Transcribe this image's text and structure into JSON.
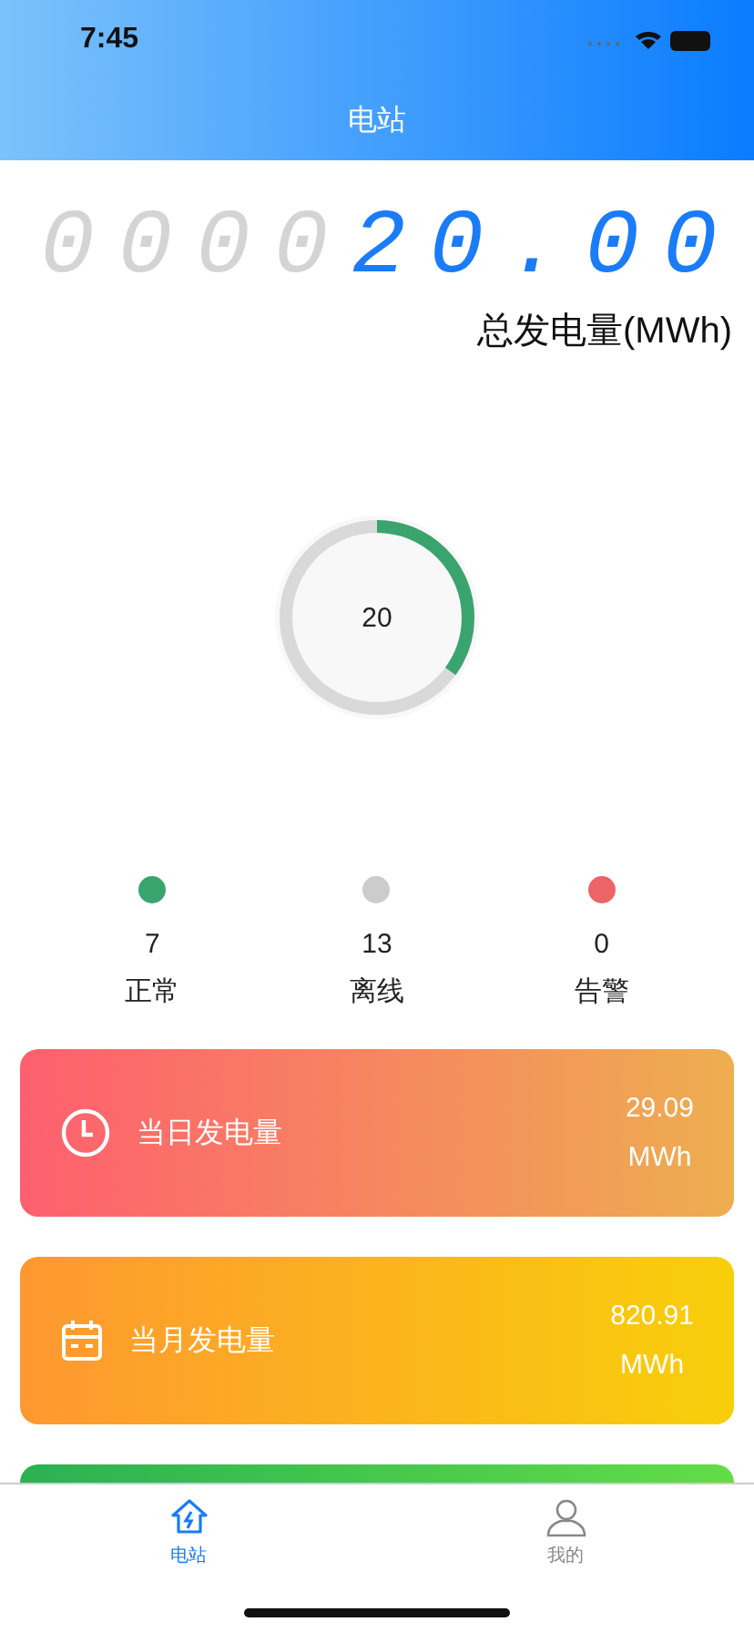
{
  "status_bar": {
    "time": "7:45"
  },
  "nav": {
    "title": "电站"
  },
  "counter": {
    "digits": [
      {
        "char": "0",
        "lit": false
      },
      {
        "char": "0",
        "lit": false
      },
      {
        "char": "0",
        "lit": false
      },
      {
        "char": "0",
        "lit": false
      },
      {
        "char": "2",
        "lit": true
      },
      {
        "char": "0",
        "lit": true
      },
      {
        "char": ".",
        "lit": true
      },
      {
        "char": "0",
        "lit": true
      },
      {
        "char": "0",
        "lit": true
      }
    ],
    "label": "总发电量(MWh)"
  },
  "gauge": {
    "value": "20",
    "level": 0.35
  },
  "statuses": [
    {
      "count": "7",
      "label": "正常",
      "color": "#3aa46f"
    },
    {
      "count": "13",
      "label": "离线",
      "color": "#cccccc"
    },
    {
      "count": "0",
      "label": "告警",
      "color": "#ee6466"
    }
  ],
  "cards": [
    {
      "kind": "daily",
      "label": "当日发电量",
      "value": "29.09",
      "unit": "MWh"
    },
    {
      "kind": "monthly",
      "label": "当月发电量",
      "value": "820.91",
      "unit": "MWh"
    },
    {
      "kind": "total"
    }
  ],
  "tabs": [
    {
      "label": "电站",
      "kind": "home",
      "selected": true
    },
    {
      "label": "我的",
      "kind": "user",
      "selected": false
    }
  ]
}
